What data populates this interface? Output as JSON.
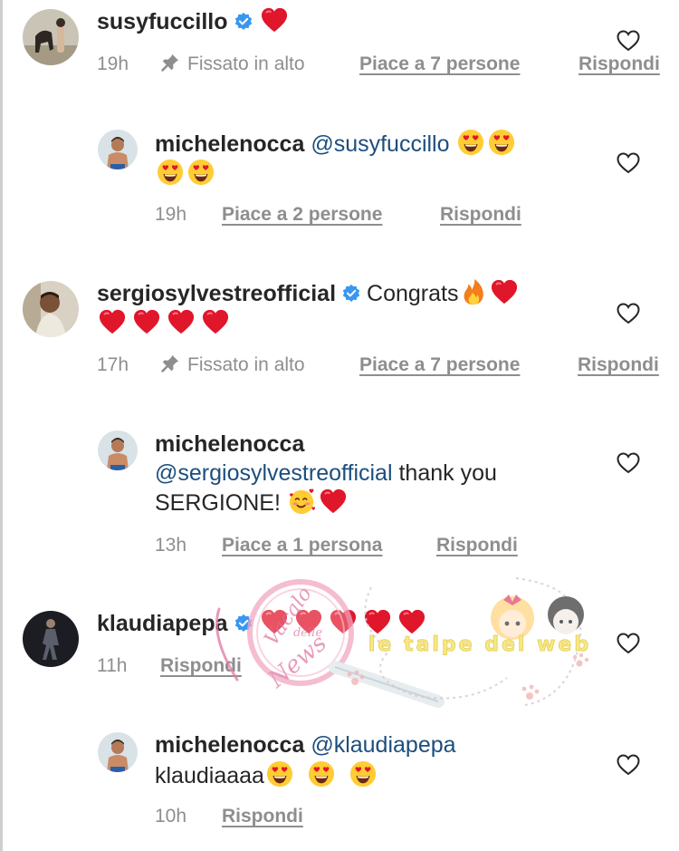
{
  "comments": [
    {
      "username": "susyfuccillo",
      "time": "19h",
      "pinned": "Fissato in alto",
      "likes": "Piace a 7 persone",
      "reply": "Rispondi"
    },
    {
      "username": "michelenocca",
      "mention": "@susyfuccillo",
      "time": "19h",
      "likes": "Piace a 2 persone",
      "reply": "Rispondi"
    },
    {
      "username": "sergiosylvestreofficial",
      "text": "Congrats",
      "time": "17h",
      "pinned": "Fissato in alto",
      "likes": "Piace a 7 persone",
      "reply": "Rispondi"
    },
    {
      "username": "michelenocca",
      "mention": "@sergiosylvestreofficial",
      "text": "thank you",
      "text2": "SERGIONE!",
      "time": "13h",
      "likes": "Piace a 1 persona",
      "reply": "Rispondi"
    },
    {
      "username": "klaudiapepa",
      "time": "11h",
      "reply": "Rispondi"
    },
    {
      "username": "michelenocca",
      "mention": "@klaudiapepa",
      "text": "klaudiaaaa",
      "time": "10h",
      "reply": "Rispondi"
    }
  ],
  "icons": {
    "heart_outline": "heart-outline-icon",
    "pin": "pin-icon",
    "verified": "verified-badge-icon",
    "red_heart_emoji": "red-heart-emoji",
    "heart_eyes_emoji": "heart-eyes-emoji",
    "fire_emoji": "fire-emoji",
    "smiling_hearts_emoji": "smiling-face-with-hearts-emoji"
  },
  "colors": {
    "text": "#262626",
    "meta": "#8e8e8e",
    "mention": "#1c4e7e",
    "verified": "#3897f0",
    "heart": "#e0162b"
  },
  "watermarks": {
    "left_line1": "Vacalo",
    "left_line2": "delle",
    "left_line3": "News",
    "right": "le talpe del web"
  }
}
